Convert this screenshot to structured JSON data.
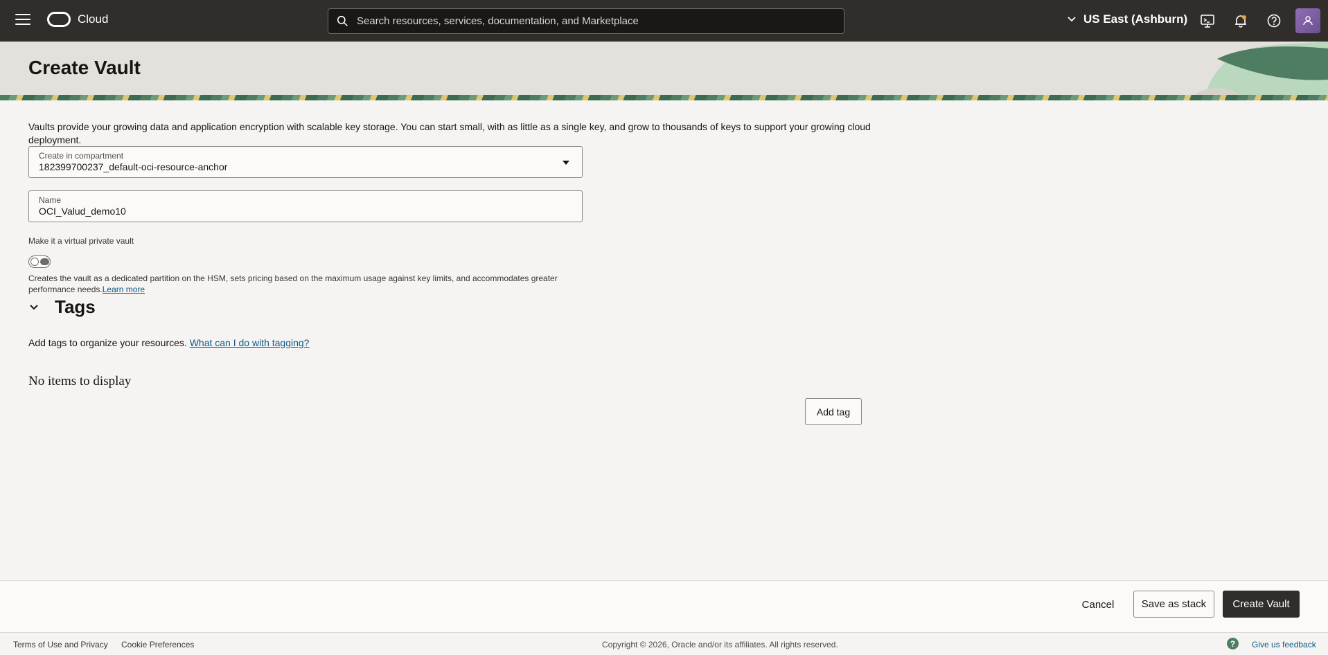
{
  "header": {
    "brand": "Cloud",
    "search_placeholder": "Search resources, services, documentation, and Marketplace",
    "region": "US East (Ashburn)",
    "icons": [
      "menu-icon",
      "oracle-logo-icon",
      "search-icon",
      "chevron-down-icon",
      "cloud-shell-icon",
      "bell-icon",
      "help-icon",
      "user-icon"
    ]
  },
  "page": {
    "title": "Create Vault",
    "description": "Vaults provide your growing data and application encryption with scalable key storage. You can start small, with as little as a single key, and grow to thousands of keys to support your growing cloud deployment."
  },
  "form": {
    "compartment_label": "Create in compartment",
    "compartment_value": "182399700237_default-oci-resource-anchor",
    "name_label": "Name",
    "name_value": "OCI_Valud_demo10",
    "vpv_label": "Make it a virtual private vault",
    "vpv_enabled": false,
    "vpv_help": "Creates the vault as a dedicated partition on the HSM, sets pricing based on the maximum usage against key limits, and accommodates greater performance needs.",
    "learn_more": "Learn more"
  },
  "tags": {
    "title": "Tags",
    "description": "Add tags to organize your resources.",
    "help_link": "What can I do with tagging?",
    "empty_text": "No items to display",
    "add_tag": "Add tag"
  },
  "actions": {
    "cancel": "Cancel",
    "save_stack": "Save as stack",
    "create": "Create Vault"
  },
  "footer": {
    "terms": "Terms of Use and Privacy",
    "cookies": "Cookie Preferences",
    "copyright": "Copyright © 2026, Oracle and/or its affiliates. All rights reserved.",
    "feedback": "Give us feedback",
    "feedback_icon_glyph": "?"
  },
  "colors": {
    "header_bg": "#312d2a",
    "page_bg": "#f5f4f2",
    "link": "#0b5a87",
    "primary_button": "#312d2a",
    "accent_green": "#4f7d62"
  }
}
